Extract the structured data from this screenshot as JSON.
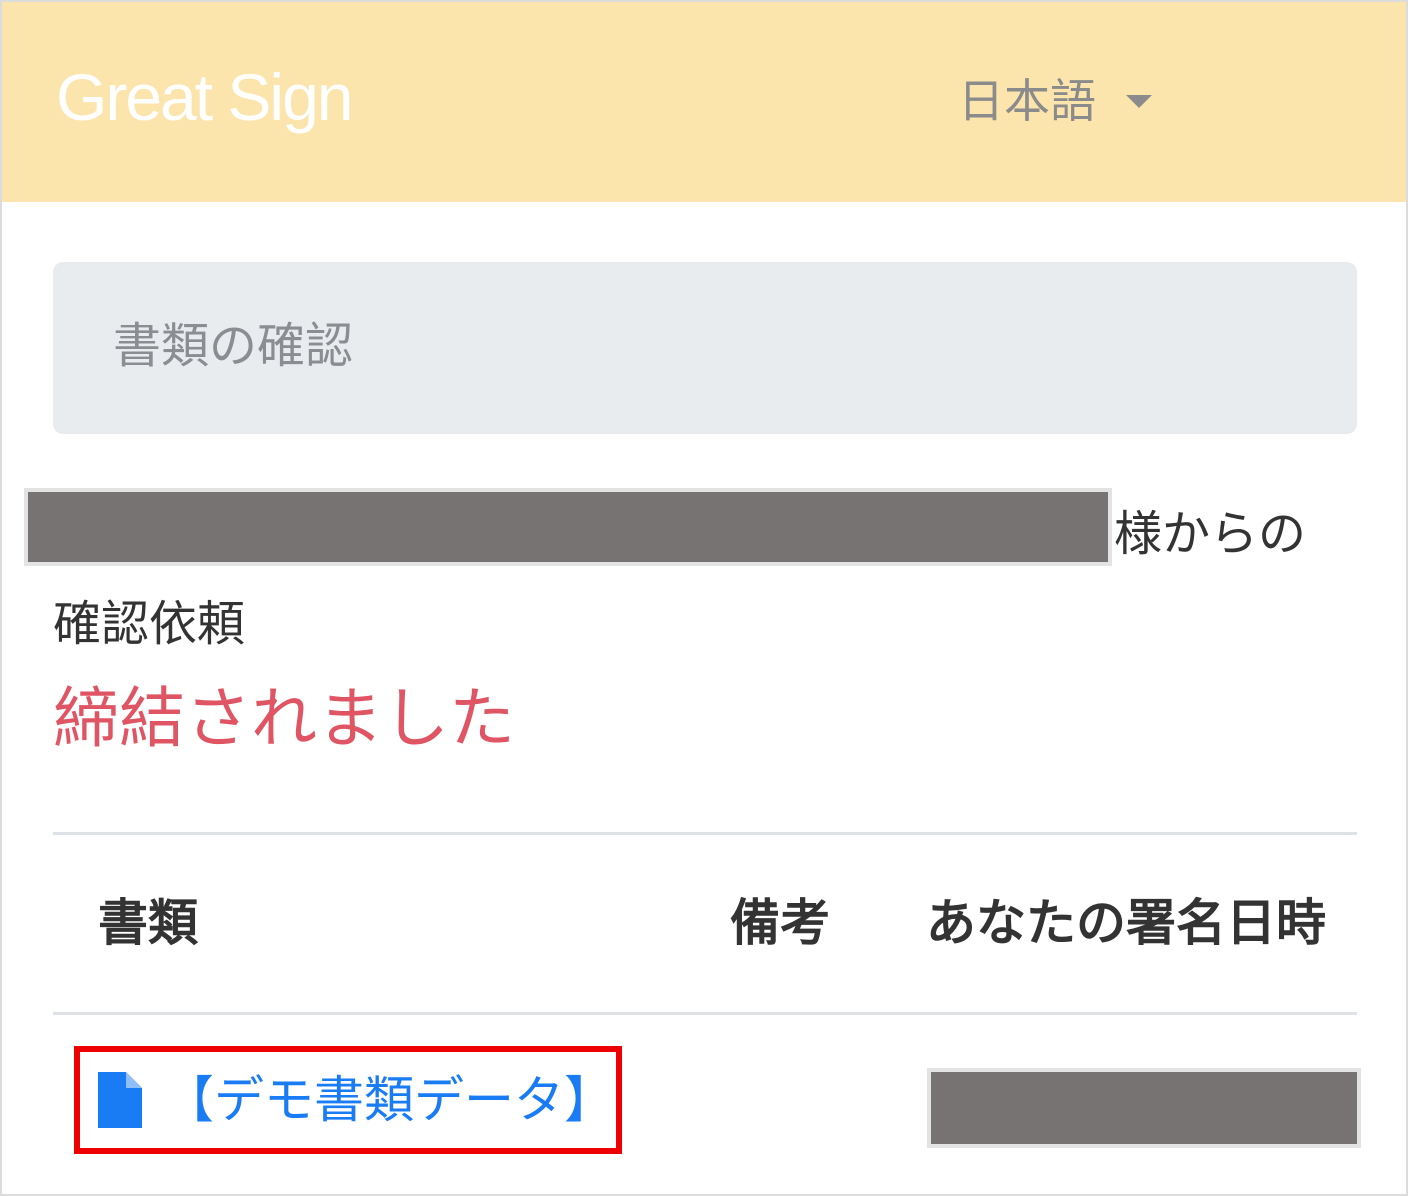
{
  "header": {
    "logo": "Great Sign",
    "language": "日本語"
  },
  "section": {
    "title": "書類の確認"
  },
  "request": {
    "sender_suffix": "様からの",
    "label": "確認依頼",
    "status": "締結されました"
  },
  "table": {
    "columns": [
      "書類",
      "備考",
      "あなたの署名日時"
    ],
    "rows": [
      {
        "document": "【デモ書類データ】",
        "note": "",
        "icon": "file-icon"
      }
    ]
  },
  "colors": {
    "header_bg": "#fce5ad",
    "status": "#e05564",
    "link": "#1a7cf5",
    "highlight_border": "#ee0000",
    "redaction": "#777372"
  }
}
